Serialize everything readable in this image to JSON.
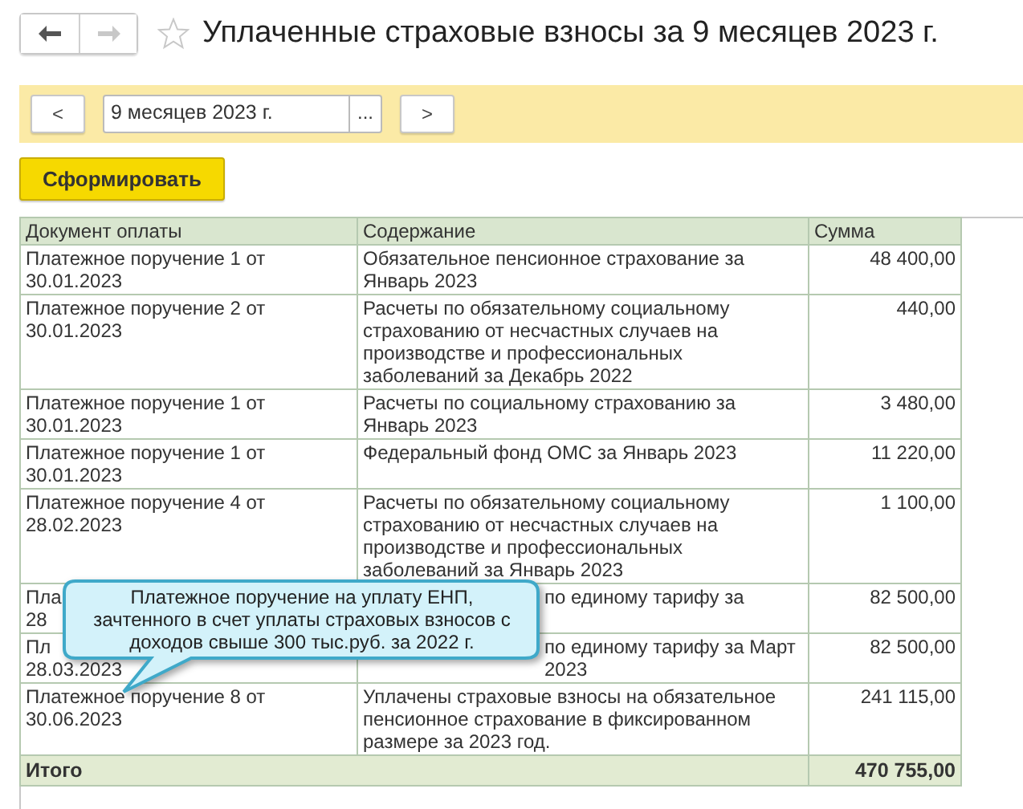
{
  "nav": {
    "back_disabled": false,
    "forward_disabled": true
  },
  "title": "Уплаченные страховые взносы за 9 месяцев 2023 г.",
  "favorite": false,
  "period": {
    "prev": "<",
    "value": "9 месяцев 2023 г.",
    "select": "...",
    "next": ">"
  },
  "generate_button": "Сформировать",
  "table": {
    "columns": [
      "Документ оплаты",
      "Содержание",
      "Сумма"
    ],
    "rows": [
      {
        "doc": "Платежное поручение 1 от\n30.01.2023",
        "content": "Обязательное пенсионное страхование за\nЯнварь 2023",
        "sum": "48 400,00",
        "covered": false
      },
      {
        "doc": "Платежное поручение 2 от\n30.01.2023",
        "content": "Расчеты по обязательному социальному\nстрахованию от несчастных случаев на\nпроизводстве и профессиональных\nзаболеваний за Декабрь 2022",
        "sum": "440,00",
        "covered": false
      },
      {
        "doc": "Платежное поручение 1 от\n30.01.2023",
        "content": "Расчеты по социальному страхованию за\nЯнварь 2023",
        "sum": "3 480,00",
        "covered": false
      },
      {
        "doc": "Платежное поручение 1 от\n30.01.2023",
        "content": "Федеральный фонд ОМС за Январь 2023",
        "sum": "11 220,00",
        "covered": false
      },
      {
        "doc": "Платежное поручение 4 от\n28.02.2023",
        "content": "Расчеты по обязательному социальному\nстрахованию от несчастных случаев на\nпроизводстве и профессиональных\nзаболеваний за Январь 2023",
        "sum": "1 100,00",
        "covered": false
      },
      {
        "doc": "Пла\n28",
        "content": "по единому тарифу за",
        "sum": "82 500,00",
        "covered": true
      },
      {
        "doc": "Пл\n28.03.2023",
        "content": "по единому тарифу за Март\n2023",
        "sum": "82 500,00",
        "covered": true
      },
      {
        "doc": "Платежное поручение 8 от\n30.06.2023",
        "content": "Уплачены страховые взносы на обязательное\nпенсионное страхование в фиксированном\nразмере за 2023 год.",
        "sum": "241 115,00",
        "covered": false
      }
    ],
    "total": {
      "label": "Итого",
      "sum": "470 755,00"
    }
  },
  "callout": "Платежное поручение на уплату ЕНП,\nзачтенного в счет уплаты страховых взносов с\nдоходов свыше 300 тыс.руб. за 2022 г."
}
